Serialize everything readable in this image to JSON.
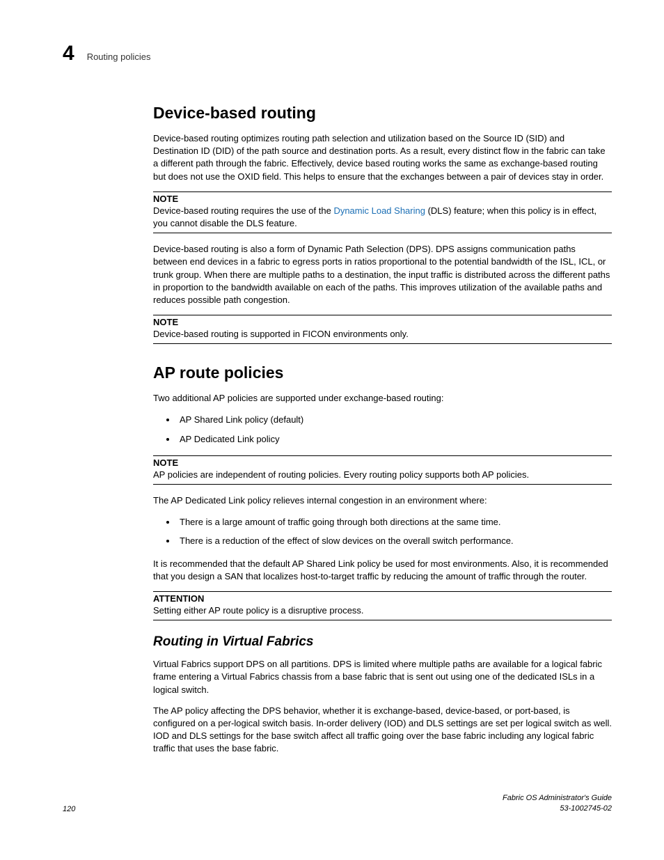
{
  "header": {
    "chapter_number": "4",
    "chapter_title": "Routing policies"
  },
  "sections": {
    "device_based_routing": {
      "heading": "Device-based routing",
      "para1": "Device-based routing optimizes routing path selection and utilization based on the Source ID (SID) and Destination ID (DID) of the path source and destination ports. As a result, every distinct flow in the fabric can take a different path through the fabric. Effectively, device based routing works the same as exchange-based routing but does not use the OXID field. This helps to ensure that the exchanges between a pair of devices stay in order.",
      "note1": {
        "label": "NOTE",
        "text_prefix": "Device-based routing requires the use of the ",
        "link_text": "Dynamic Load Sharing",
        "text_suffix": " (DLS) feature; when this policy is in effect, you cannot disable the DLS feature."
      },
      "para2": "Device-based routing is also a form of Dynamic Path Selection (DPS). DPS assigns communication paths between end devices in a fabric to egress ports in ratios proportional to the potential bandwidth of the ISL, ICL, or trunk group. When there are multiple paths to a destination, the input traffic is distributed across the different paths in proportion to the bandwidth available on each of the paths. This improves utilization of the available paths and reduces possible path congestion.",
      "note2": {
        "label": "NOTE",
        "text": "Device-based routing is supported in FICON environments only."
      }
    },
    "ap_route_policies": {
      "heading": "AP route policies",
      "intro": "Two additional AP policies are supported under exchange-based routing:",
      "list1": [
        "AP Shared Link policy (default)",
        "AP Dedicated Link policy"
      ],
      "note1": {
        "label": "NOTE",
        "text": " AP policies are independent of routing policies. Every routing policy supports both AP policies."
      },
      "para1": "The AP Dedicated Link policy relieves internal congestion in an environment where:",
      "list2": [
        "There is a large amount of traffic going through both directions at the same time.",
        "There is a reduction of the effect of slow devices on the overall switch performance."
      ],
      "para2": "It is recommended that the default AP Shared Link policy be used for most environments. Also, it is recommended that you design a SAN that localizes host-to-target traffic by reducing the amount of traffic through the router.",
      "attention": {
        "label": "ATTENTION",
        "text": "Setting either AP route policy is a disruptive process."
      }
    },
    "routing_virtual_fabrics": {
      "heading": "Routing in Virtual Fabrics",
      "para1": "Virtual Fabrics support DPS on all partitions. DPS is limited where multiple paths are available for a logical fabric frame entering a Virtual Fabrics chassis from a base fabric that is sent out using one of the dedicated ISLs in a logical switch.",
      "para2": "The AP policy affecting the DPS behavior, whether it is exchange-based, device-based, or port-based, is configured on a per-logical switch basis. In-order delivery (IOD) and DLS settings are set per logical switch as well. IOD and DLS settings for the base switch affect all traffic going over the base fabric including any logical fabric traffic that uses the base fabric."
    }
  },
  "footer": {
    "page_number": "120",
    "doc_title": "Fabric OS Administrator's Guide",
    "doc_id": "53-1002745-02"
  }
}
